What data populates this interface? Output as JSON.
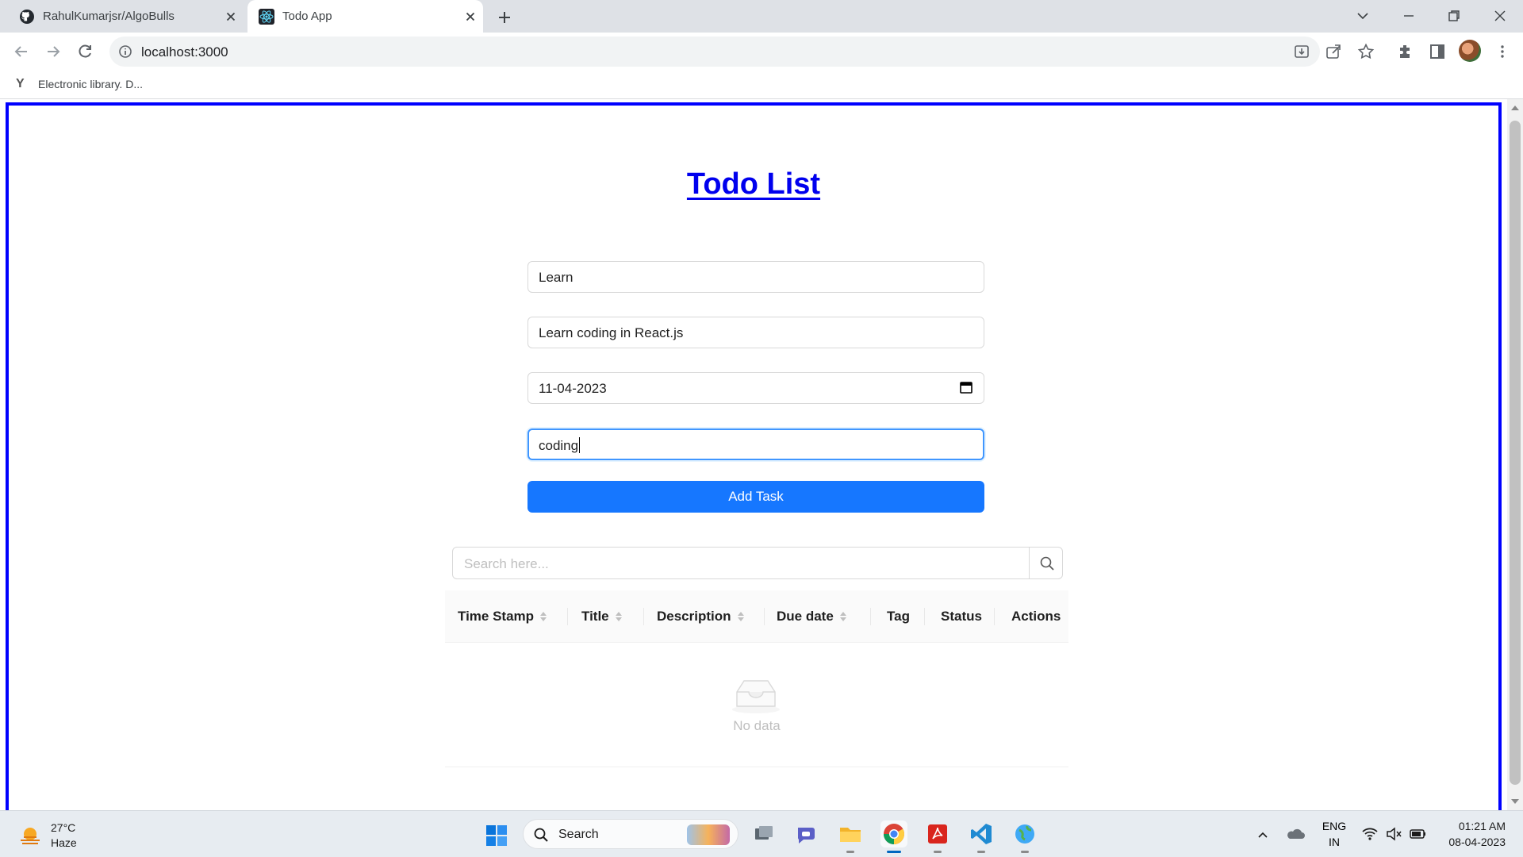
{
  "browser": {
    "tabs": [
      {
        "title": "RahulKumarjsr/AlgoBulls",
        "icon": "github-icon"
      },
      {
        "title": "Todo App",
        "icon": "react-icon"
      }
    ],
    "url": "localhost:3000",
    "bookmarks": [
      {
        "label": "Electronic library. D...",
        "icon": "Y"
      }
    ]
  },
  "app": {
    "title": "Todo List",
    "form": {
      "title_value": "Learn",
      "description_value": "Learn coding in React.js",
      "due_date_value": "11-04-2023",
      "tag_value": "coding",
      "submit_label": "Add Task"
    },
    "search": {
      "placeholder": "Search here..."
    },
    "table": {
      "columns": [
        {
          "label": "Time Stamp",
          "sortable": true
        },
        {
          "label": "Title",
          "sortable": true
        },
        {
          "label": "Description",
          "sortable": true
        },
        {
          "label": "Due date",
          "sortable": true
        },
        {
          "label": "Tag",
          "sortable": false
        },
        {
          "label": "Status",
          "sortable": false
        },
        {
          "label": "Actions",
          "sortable": false
        }
      ],
      "empty_text": "No data"
    }
  },
  "taskbar": {
    "weather_temp": "27°C",
    "weather_desc": "Haze",
    "search_label": "Search",
    "lang_line1": "ENG",
    "lang_line2": "IN",
    "time": "01:21 AM",
    "date": "08-04-2023"
  },
  "colors": {
    "accent": "#1677ff",
    "page_border": "#0000ff",
    "heading_link": "#0000ee"
  }
}
